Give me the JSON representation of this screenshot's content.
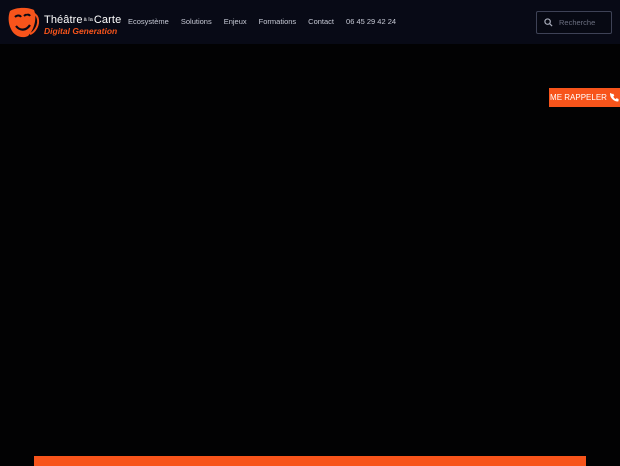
{
  "brand": {
    "line1_part1": "Théâtre",
    "line1_small": "à la",
    "line1_part2": "Carte",
    "line2": "Digital Generation",
    "accent_color": "#f7541b"
  },
  "nav": {
    "items": [
      {
        "label": "Ecosystème"
      },
      {
        "label": "Solutions"
      },
      {
        "label": "Enjeux"
      },
      {
        "label": "Formations"
      },
      {
        "label": "Contact"
      },
      {
        "label": "06 45 29 42 24"
      }
    ]
  },
  "search": {
    "placeholder": "Recherche",
    "icon": "search-icon"
  },
  "callback": {
    "label": "ME RAPPELER",
    "icon": "phone-icon"
  }
}
